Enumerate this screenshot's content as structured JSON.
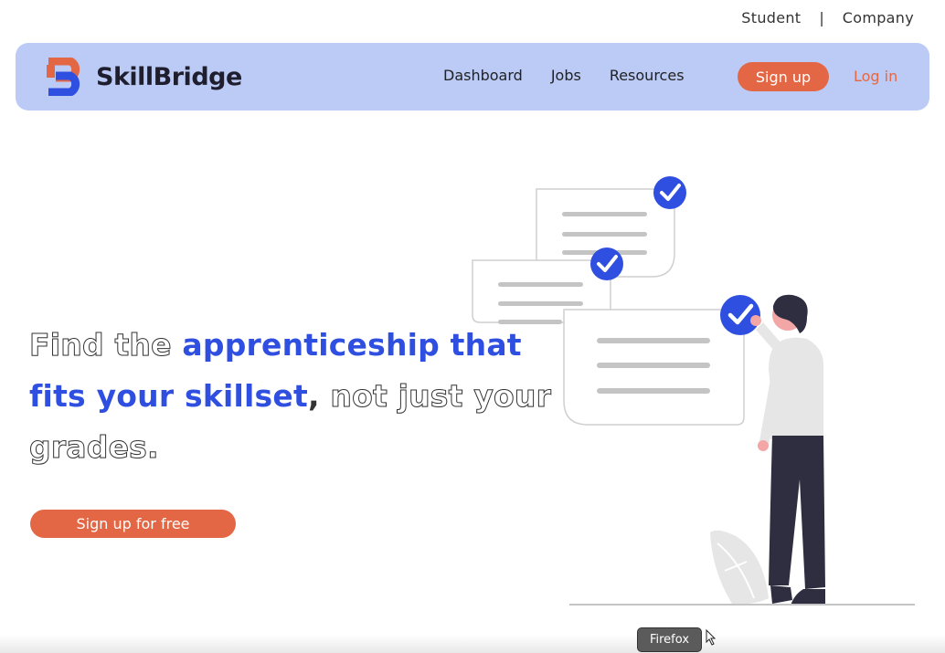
{
  "topbar": {
    "student": "Student",
    "separator": "|",
    "company": "Company"
  },
  "brand": {
    "name": "SkillBridge",
    "colors": {
      "orange": "#e36745",
      "blue": "#2f4fe0"
    }
  },
  "nav": {
    "dashboard": "Dashboard",
    "jobs": "Jobs",
    "resources": "Resources",
    "signup": "Sign up",
    "login": "Log in"
  },
  "hero": {
    "part1": "Find the ",
    "part2": "apprenticeship that fits your skillset",
    "part3": ",",
    "part4": " not just your grades.",
    "cta": "Sign up for free"
  },
  "tooltip": "Firefox",
  "colors": {
    "navbar_bg": "#bccbf5",
    "accent": "#2f4fe0",
    "button": "#e36745"
  }
}
